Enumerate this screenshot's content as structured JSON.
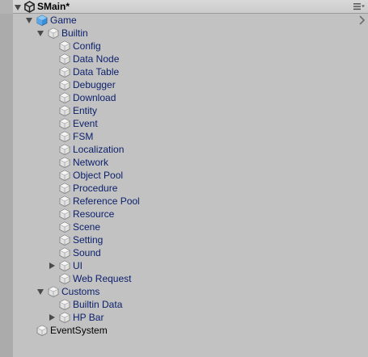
{
  "scene": {
    "title": "SMain*",
    "icon": "unity-logo-icon"
  },
  "tree": [
    {
      "id": "game",
      "label": "Game",
      "depth": 0,
      "foldout": "expanded",
      "icon": "prefab-cube-icon",
      "style": "prefab"
    },
    {
      "id": "builtin",
      "label": "Builtin",
      "depth": 1,
      "foldout": "expanded",
      "icon": "gameobject-icon",
      "style": "prefab"
    },
    {
      "id": "config",
      "label": "Config",
      "depth": 2,
      "foldout": "none",
      "icon": "gameobject-icon",
      "style": "prefab"
    },
    {
      "id": "data-node",
      "label": "Data Node",
      "depth": 2,
      "foldout": "none",
      "icon": "gameobject-icon",
      "style": "prefab"
    },
    {
      "id": "data-table",
      "label": "Data Table",
      "depth": 2,
      "foldout": "none",
      "icon": "gameobject-icon",
      "style": "prefab"
    },
    {
      "id": "debugger",
      "label": "Debugger",
      "depth": 2,
      "foldout": "none",
      "icon": "gameobject-icon",
      "style": "prefab"
    },
    {
      "id": "download",
      "label": "Download",
      "depth": 2,
      "foldout": "none",
      "icon": "gameobject-icon",
      "style": "prefab"
    },
    {
      "id": "entity",
      "label": "Entity",
      "depth": 2,
      "foldout": "none",
      "icon": "gameobject-icon",
      "style": "prefab"
    },
    {
      "id": "event",
      "label": "Event",
      "depth": 2,
      "foldout": "none",
      "icon": "gameobject-icon",
      "style": "prefab"
    },
    {
      "id": "fsm",
      "label": "FSM",
      "depth": 2,
      "foldout": "none",
      "icon": "gameobject-icon",
      "style": "prefab"
    },
    {
      "id": "localization",
      "label": "Localization",
      "depth": 2,
      "foldout": "none",
      "icon": "gameobject-icon",
      "style": "prefab"
    },
    {
      "id": "network",
      "label": "Network",
      "depth": 2,
      "foldout": "none",
      "icon": "gameobject-icon",
      "style": "prefab"
    },
    {
      "id": "object-pool",
      "label": "Object Pool",
      "depth": 2,
      "foldout": "none",
      "icon": "gameobject-icon",
      "style": "prefab"
    },
    {
      "id": "procedure",
      "label": "Procedure",
      "depth": 2,
      "foldout": "none",
      "icon": "gameobject-icon",
      "style": "prefab"
    },
    {
      "id": "reference-pool",
      "label": "Reference Pool",
      "depth": 2,
      "foldout": "none",
      "icon": "gameobject-icon",
      "style": "prefab"
    },
    {
      "id": "resource",
      "label": "Resource",
      "depth": 2,
      "foldout": "none",
      "icon": "gameobject-icon",
      "style": "prefab"
    },
    {
      "id": "scene",
      "label": "Scene",
      "depth": 2,
      "foldout": "none",
      "icon": "gameobject-icon",
      "style": "prefab"
    },
    {
      "id": "setting",
      "label": "Setting",
      "depth": 2,
      "foldout": "none",
      "icon": "gameobject-icon",
      "style": "prefab"
    },
    {
      "id": "sound",
      "label": "Sound",
      "depth": 2,
      "foldout": "none",
      "icon": "gameobject-icon",
      "style": "prefab"
    },
    {
      "id": "ui",
      "label": "UI",
      "depth": 2,
      "foldout": "collapsed",
      "icon": "gameobject-icon",
      "style": "prefab"
    },
    {
      "id": "web-request",
      "label": "Web Request",
      "depth": 2,
      "foldout": "none",
      "icon": "gameobject-icon",
      "style": "prefab"
    },
    {
      "id": "customs",
      "label": "Customs",
      "depth": 1,
      "foldout": "expanded",
      "icon": "gameobject-icon",
      "style": "prefab"
    },
    {
      "id": "builtin-data",
      "label": "Builtin Data",
      "depth": 2,
      "foldout": "none",
      "icon": "gameobject-icon",
      "style": "prefab"
    },
    {
      "id": "hp-bar",
      "label": "HP Bar",
      "depth": 2,
      "foldout": "collapsed",
      "icon": "gameobject-icon",
      "style": "prefab"
    },
    {
      "id": "eventsystem",
      "label": "EventSystem",
      "depth": 0,
      "foldout": "none",
      "icon": "gameobject-icon",
      "style": "plain"
    }
  ],
  "colors": {
    "background": "#c2c2c2",
    "prefab_text": "#0a1f6b",
    "plain_text": "#000000",
    "prefab_cube_blue": "#3b8fd8"
  }
}
